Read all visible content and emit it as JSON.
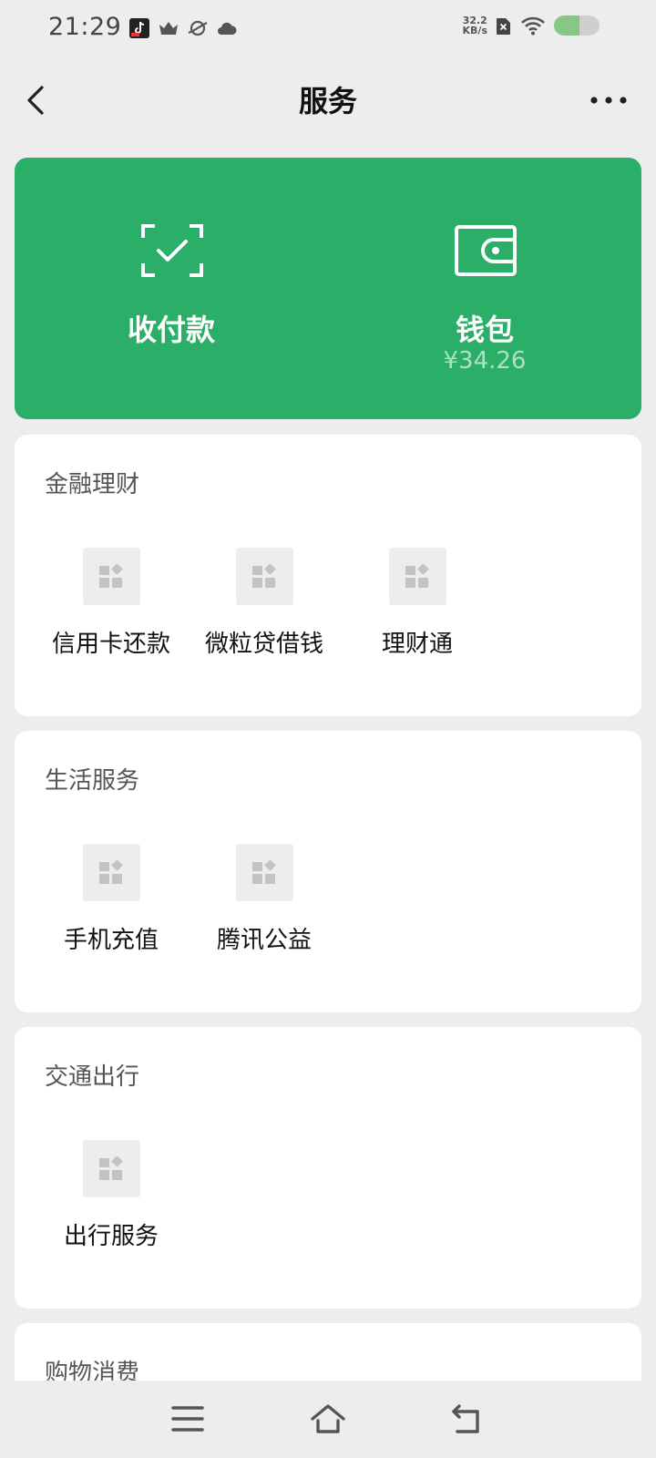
{
  "status_bar": {
    "time": "21:29",
    "net_speed_value": "32.2",
    "net_speed_unit": "KB/s",
    "battery_level": 0.55
  },
  "nav": {
    "title": "服务"
  },
  "pay_card": {
    "collect_label": "收付款",
    "wallet_label": "钱包",
    "wallet_balance": "¥34.26"
  },
  "sections": [
    {
      "title": "金融理财",
      "items": [
        "信用卡还款",
        "微粒贷借钱",
        "理财通"
      ]
    },
    {
      "title": "生活服务",
      "items": [
        "手机充值",
        "腾讯公益"
      ]
    },
    {
      "title": "交通出行",
      "items": [
        "出行服务"
      ]
    },
    {
      "title": "购物消费",
      "items": []
    }
  ],
  "colors": {
    "brand_green": "#2bae67",
    "page_background": "#ededed"
  }
}
